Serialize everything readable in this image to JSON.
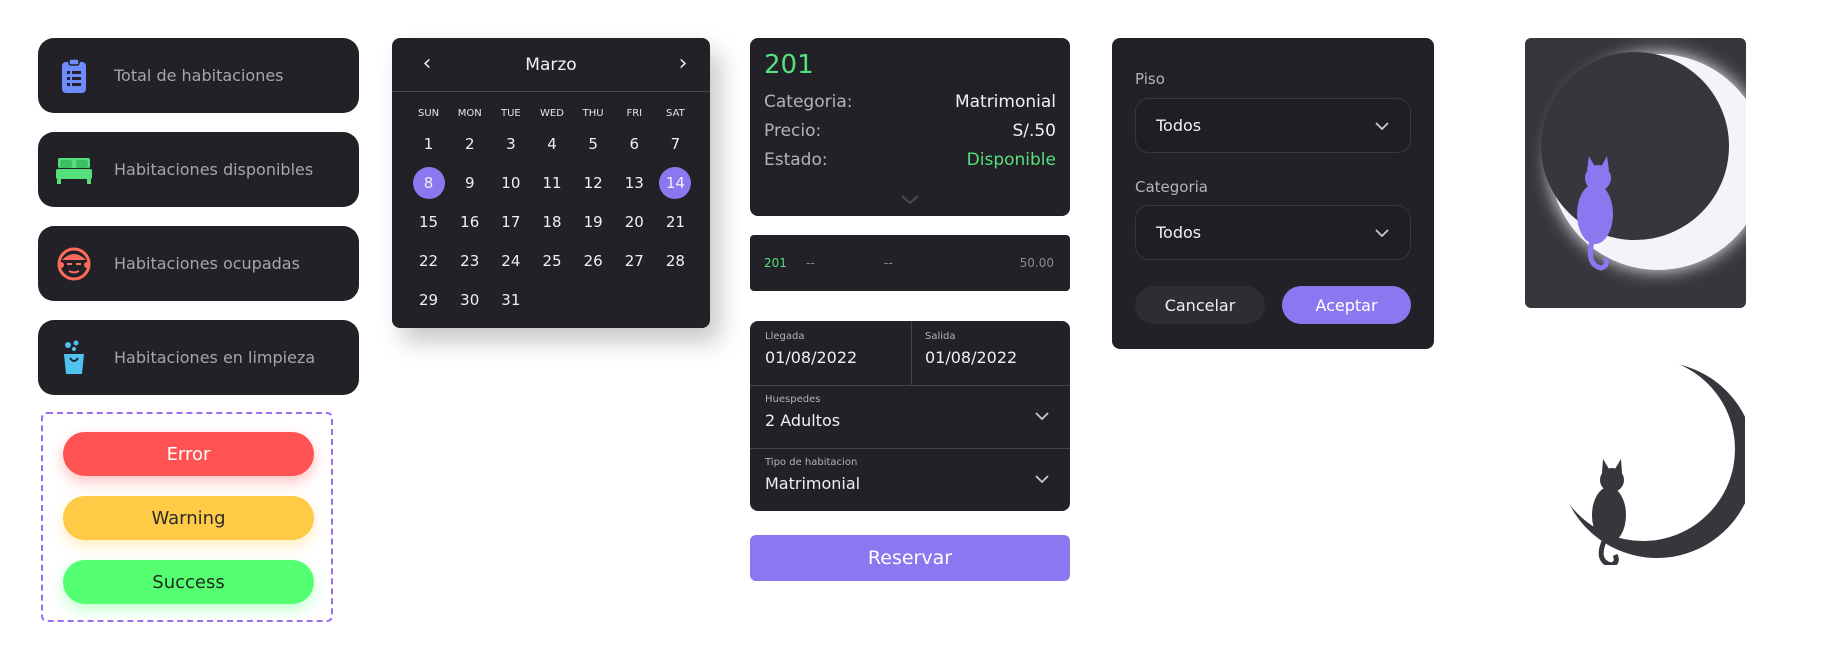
{
  "stats": [
    {
      "label": "Total de habitaciones",
      "icon": "clipboard-list-icon",
      "color": "#6f8cff"
    },
    {
      "label": "Habitaciones disponibles",
      "icon": "bed-icon",
      "color": "#54e07a"
    },
    {
      "label": "Habitaciones ocupadas",
      "icon": "occupied-face-icon",
      "color": "#ff6b5b"
    },
    {
      "label": "Habitaciones en limpieza",
      "icon": "cleaning-bucket-icon",
      "color": "#4ec3f0"
    }
  ],
  "status_buttons": {
    "error": "Error",
    "warning": "Warning",
    "success": "Success"
  },
  "calendar": {
    "month": "Marzo",
    "weekdays": [
      "SUN",
      "MON",
      "TUE",
      "WED",
      "THU",
      "FRI",
      "SAT"
    ],
    "weeks": [
      [
        "1",
        "2",
        "3",
        "4",
        "5",
        "6",
        "7"
      ],
      [
        "8",
        "9",
        "10",
        "11",
        "12",
        "13",
        "14"
      ],
      [
        "15",
        "16",
        "17",
        "18",
        "19",
        "20",
        "21"
      ],
      [
        "22",
        "23",
        "24",
        "25",
        "26",
        "27",
        "28"
      ],
      [
        "29",
        "30",
        "31",
        "",
        "",
        "",
        ""
      ]
    ],
    "selected": [
      "8",
      "14"
    ]
  },
  "room_card": {
    "number": "201",
    "rows": [
      {
        "key": "Categoria:",
        "value": "Matrimonial"
      },
      {
        "key": "Precio:",
        "value": "S/.50"
      },
      {
        "key": "Estado:",
        "value": "Disponible"
      }
    ]
  },
  "room_strip": {
    "number": "201",
    "field1": "--",
    "field2": "--",
    "price": "50.00"
  },
  "booking": {
    "arrive_label": "Llegada",
    "arrive_value": "01/08/2022",
    "leave_label": "Salida",
    "leave_value": "01/08/2022",
    "guests_label": "Huespedes",
    "guests_value": "2 Adultos",
    "type_label": "Tipo de habitacion",
    "type_value": "Matrimonial",
    "submit": "Reservar"
  },
  "filter": {
    "floor_label": "Piso",
    "floor_value": "Todos",
    "category_label": "Categoria",
    "category_value": "Todos",
    "cancel": "Cancelar",
    "accept": "Aceptar"
  },
  "colors": {
    "panel": "#222127",
    "accent": "#8a78f0",
    "green": "#54e07a",
    "error": "#ff5353",
    "warning": "#ffcb47",
    "success": "#54ff72"
  },
  "illustrations": [
    "moon-cat-glow-illustration",
    "moon-cat-dark-illustration"
  ]
}
